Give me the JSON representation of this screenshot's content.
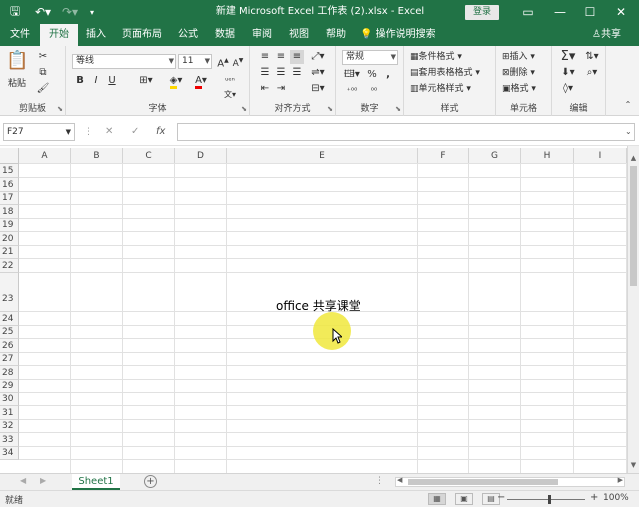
{
  "window": {
    "title": "新建 Microsoft Excel 工作表 (2).xlsx  -  Excel",
    "login_label": "登录"
  },
  "tabs": [
    "文件",
    "开始",
    "插入",
    "页面布局",
    "公式",
    "数据",
    "审阅",
    "视图",
    "帮助"
  ],
  "active_tab": "开始",
  "tell_me": "操作说明搜索",
  "share": "共享",
  "ribbon": {
    "clipboard": {
      "paste": "粘贴",
      "label": "剪贴板"
    },
    "font": {
      "name": "等线",
      "size": "11",
      "bold": "B",
      "italic": "I",
      "underline": "U",
      "label": "字体"
    },
    "alignment": {
      "label": "对齐方式"
    },
    "number": {
      "format": "常规",
      "percent": "%",
      "comma": ",",
      "label": "数字"
    },
    "styles": {
      "conditional": "条件格式",
      "table": "套用表格格式",
      "cell": "单元格样式",
      "label": "样式"
    },
    "cells": {
      "insert": "插入",
      "delete": "删除",
      "format": "格式",
      "label": "单元格"
    },
    "editing": {
      "label": "编辑"
    }
  },
  "formula_bar": {
    "name_box": "F27",
    "cancel": "✕",
    "enter": "✓",
    "fx": "fx",
    "value": ""
  },
  "sheet": {
    "columns": [
      "A",
      "B",
      "C",
      "D",
      "E",
      "F",
      "G",
      "H",
      "I"
    ],
    "rows": [
      "15",
      "16",
      "17",
      "18",
      "19",
      "20",
      "21",
      "22",
      "23",
      "24",
      "25",
      "26",
      "27",
      "28",
      "29",
      "30",
      "31",
      "32",
      "33",
      "34"
    ],
    "cell_e23": "office 共享课堂"
  },
  "sheet_tabs": [
    "Sheet1"
  ],
  "status": {
    "ready": "就绪",
    "zoom": "100%"
  },
  "colors": {
    "brand": "#217346",
    "highlight": "#f0e83c"
  }
}
